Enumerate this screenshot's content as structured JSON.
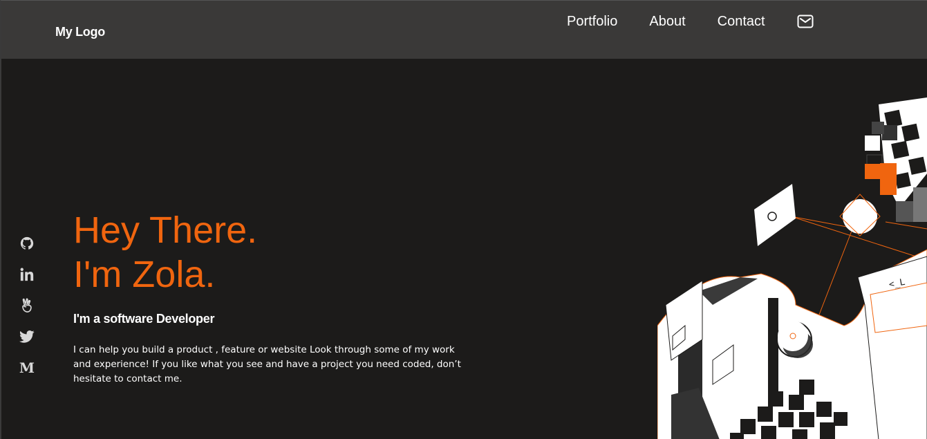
{
  "header": {
    "logo": "My Logo",
    "nav": [
      {
        "label": "Portfolio"
      },
      {
        "label": "About"
      },
      {
        "label": "Contact"
      }
    ],
    "mail_icon": "mail-icon"
  },
  "hero": {
    "title_line1": "Hey There.",
    "title_line2": "I'm Zola.",
    "subtitle": "I'm a software Developer",
    "description": "I can help you build a product , feature or website Look through some of my work and experience! If you like what you see and have a project you need coded, don’t hesitate to contact me."
  },
  "social": [
    {
      "icon": "github-icon"
    },
    {
      "icon": "linkedin-icon"
    },
    {
      "icon": "angellist-icon"
    },
    {
      "icon": "twitter-icon"
    },
    {
      "icon": "medium-icon",
      "glyph": "M"
    }
  ],
  "illustration": {
    "code_tag": "<_L"
  },
  "colors": {
    "accent": "#f0650f",
    "header_bg": "#3a3938",
    "page_bg": "#1c1b1a",
    "text": "#ffffff"
  }
}
